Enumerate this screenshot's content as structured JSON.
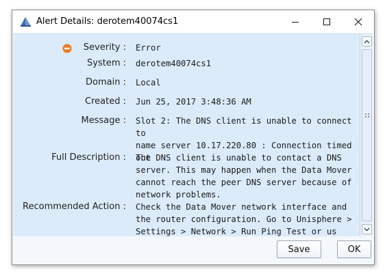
{
  "window": {
    "title": "Alert Details: derotem40074cs1"
  },
  "details": [
    {
      "label": "Severity :",
      "value": "Error"
    },
    {
      "label": "System :",
      "value": "derotem40074cs1"
    },
    {
      "label": "Domain :",
      "value": "Local"
    },
    {
      "label": "Created :",
      "value": "Jun 25, 2017 3:48:36 AM"
    },
    {
      "label": "Message :",
      "value_lines": [
        "Slot 2: The DNS client is unable to connect to",
        "name server 10.17.220.80 : Connection timed",
        "out"
      ]
    },
    {
      "label": "Full Description :",
      "value_lines": [
        "The DNS client is unable to contact a DNS",
        "server. This may happen when the Data Mover",
        "cannot reach the peer DNS server because of",
        "network problems."
      ]
    },
    {
      "label": "Recommended Action :",
      "value_lines": [
        "Check the Data Mover network interface and",
        "the router configuration. Go to Unisphere >",
        "Settings > Network > Run Ping Test or us the"
      ]
    }
  ],
  "buttons": {
    "save": "Save",
    "ok": "OK"
  },
  "colors": {
    "content_bg": "#dcebfa",
    "severity_error": "#f07a1e"
  },
  "icons": {
    "app": "alert-details-app-icon",
    "severity": "severity-error-icon"
  }
}
